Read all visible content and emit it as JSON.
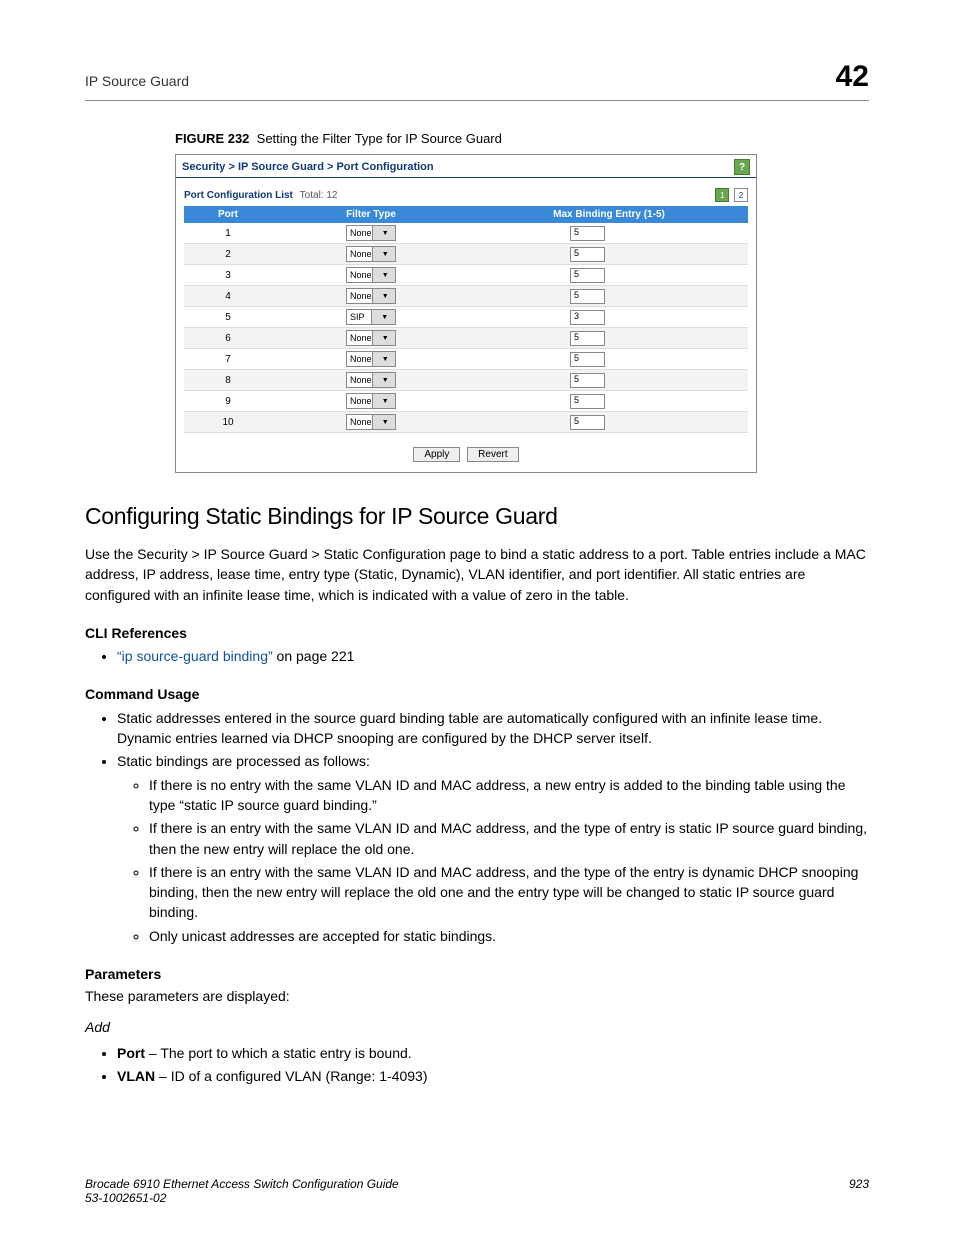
{
  "header": {
    "section": "IP Source Guard",
    "chapter": "42"
  },
  "figure": {
    "label": "FIGURE 232",
    "caption": "Setting the Filter Type for IP Source Guard",
    "breadcrumb": "Security > IP Source Guard > Port Configuration",
    "list_label": "Port Configuration List",
    "total_label": "Total: 12",
    "pages": [
      "1",
      "2"
    ],
    "columns": [
      "Port",
      "Filter Type",
      "Max Binding Entry (1-5)"
    ],
    "rows": [
      {
        "port": "1",
        "filter": "None",
        "max": "5"
      },
      {
        "port": "2",
        "filter": "None",
        "max": "5"
      },
      {
        "port": "3",
        "filter": "None",
        "max": "5"
      },
      {
        "port": "4",
        "filter": "None",
        "max": "5"
      },
      {
        "port": "5",
        "filter": "SIP",
        "max": "3"
      },
      {
        "port": "6",
        "filter": "None",
        "max": "5"
      },
      {
        "port": "7",
        "filter": "None",
        "max": "5"
      },
      {
        "port": "8",
        "filter": "None",
        "max": "5"
      },
      {
        "port": "9",
        "filter": "None",
        "max": "5"
      },
      {
        "port": "10",
        "filter": "None",
        "max": "5"
      }
    ],
    "apply": "Apply",
    "revert": "Revert"
  },
  "h2": "Configuring Static Bindings for IP Source Guard",
  "para1": "Use the Security > IP Source Guard > Static Configuration page to bind a static address to a port. Table entries include a MAC address, IP address, lease time, entry type (Static, Dynamic), VLAN identifier, and port identifier. All static entries are configured with an infinite lease time, which is indicated with a value of zero in the table.",
  "cli_head": "CLI References",
  "cli_link": "“ip source-guard binding”",
  "cli_rest": " on page 221",
  "usage_head": "Command Usage",
  "usage": [
    "Static addresses entered in the source guard binding table are automatically configured with an infinite lease time. Dynamic entries learned via DHCP snooping are configured by the DHCP server itself.",
    "Static bindings are processed as follows:"
  ],
  "usage_sub": [
    "If there is no entry with the same VLAN ID and MAC address, a new entry is added to the binding table using the type “static IP source guard binding.”",
    "If there is an entry with the same VLAN ID and MAC address, and the type of entry is static IP source guard binding, then the new entry will replace the old one.",
    "If there is an entry with the same VLAN ID and MAC address, and the type of the entry is dynamic DHCP snooping binding, then the new entry will replace the old one and the entry type will be changed to static IP source guard binding.",
    "Only unicast addresses are accepted for static bindings."
  ],
  "params_head": "Parameters",
  "params_intro": "These parameters are displayed:",
  "params_sub": "Add",
  "params": [
    {
      "name": "Port",
      "desc": " – The port to which a static entry is bound."
    },
    {
      "name": "VLAN",
      "desc": " – ID of a configured VLAN (Range: 1-4093)"
    }
  ],
  "footer": {
    "left1": "Brocade 6910 Ethernet Access Switch Configuration Guide",
    "left2": "53-1002651-02",
    "page": "923"
  }
}
